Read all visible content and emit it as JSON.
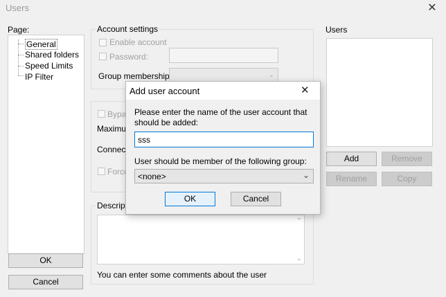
{
  "window": {
    "title": "Users",
    "close_glyph": "✕"
  },
  "page_panel": {
    "label": "Page:",
    "items": [
      "General",
      "Shared folders",
      "Speed Limits",
      "IP Filter"
    ]
  },
  "account_settings": {
    "legend": "Account settings",
    "enable_account": "Enable account",
    "password": "Password:",
    "group_membership": "Group membership:"
  },
  "hidden_options": {
    "bypass": "Bypas",
    "maximum": "Maximum",
    "connections": "Connecti",
    "force": "Force"
  },
  "description": {
    "legend": "Descriptio",
    "hint": "You can enter some comments about the user"
  },
  "users_panel": {
    "label": "Users",
    "add": "Add",
    "remove": "Remove",
    "rename": "Rename",
    "copy": "Copy"
  },
  "footer": {
    "ok": "OK",
    "cancel": "Cancel"
  },
  "dialog": {
    "title": "Add user account",
    "close_glyph": "✕",
    "prompt": "Please enter the name of the user account that should be added:",
    "name_value": "sss",
    "group_prompt": "User should be member of the following group:",
    "group_value": "<none>",
    "ok": "OK",
    "cancel": "Cancel"
  }
}
